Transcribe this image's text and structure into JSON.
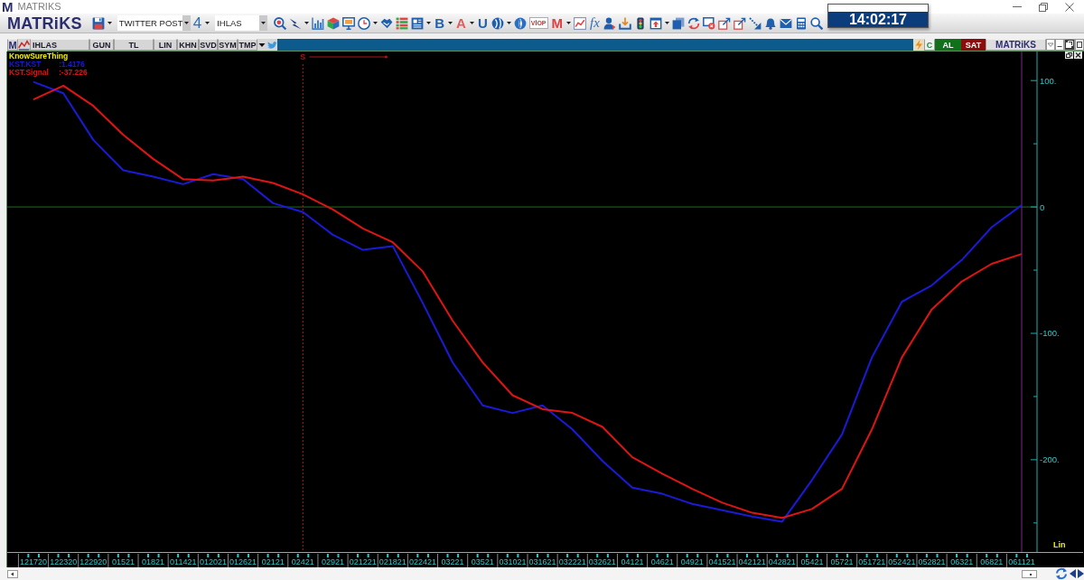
{
  "window": {
    "icon_text": "M",
    "title": "MATRIKS"
  },
  "toolbar": {
    "logo": "MATRiKS",
    "layout_select": {
      "value": "TWITTER POST"
    },
    "page_number": "4",
    "symbol_select": {
      "value": "IHLAS"
    },
    "letter_buttons": [
      {
        "label": "B",
        "color": "#1f5fae"
      },
      {
        "label": "A",
        "color": "#e85a5a"
      },
      {
        "label": "U",
        "color": "#1f5fae"
      },
      {
        "label": "M",
        "color": "#e04040"
      }
    ],
    "viop_label": "VİOP",
    "formula_label": "fx"
  },
  "clock": {
    "time": "14:02:17"
  },
  "chart_window": {
    "logo_text": "M",
    "symbol": "IHLAS",
    "buttons": [
      "GUN",
      "TL",
      "LIN",
      "KHN",
      "SVD",
      "SYM",
      "TMP"
    ],
    "status_letter": "C",
    "buy_label": "AL",
    "sell_label": "SAT",
    "brand": "MATRiKS"
  },
  "chart": {
    "legend_readings": [
      ":1.4176",
      ":-37.226"
    ],
    "scale_mode": "Lin",
    "chart_data": {
      "type": "line",
      "title": "KnowSureThing",
      "categories": [
        "121720",
        "122320",
        "122920",
        "01521",
        "01821",
        "011421",
        "012021",
        "012621",
        "02121",
        "02421",
        "02921",
        "021221",
        "021821",
        "022421",
        "03221",
        "03521",
        "031021",
        "031621",
        "032221",
        "032621",
        "04121",
        "04621",
        "04921",
        "041521",
        "042121",
        "042821",
        "05421",
        "05721",
        "051721",
        "052421",
        "052821",
        "06321",
        "06821",
        "061121"
      ],
      "series": [
        {
          "name": "KST.KST",
          "color": "#1a1ad8",
          "values": [
            99,
            90,
            53,
            29,
            24,
            18,
            26,
            22,
            3,
            -4,
            -22,
            -34,
            -31,
            -76,
            -123,
            -157,
            -163,
            -157,
            -176,
            -201,
            -222,
            -227,
            -235,
            -240,
            -245,
            -249,
            -216,
            -180,
            -119,
            -75,
            -62,
            -42,
            -16,
            1.4
          ]
        },
        {
          "name": "KST.Signal",
          "color": "#e01414",
          "values": [
            85,
            96,
            80,
            57,
            38,
            22,
            21,
            24,
            19,
            10,
            -2,
            -17,
            -28,
            -51,
            -90,
            -123,
            -149,
            -160,
            -163,
            -174,
            -198,
            -211,
            -223,
            -234,
            -242,
            -246,
            -239,
            -223,
            -176,
            -119,
            -81,
            -59,
            -45,
            -37.2
          ]
        }
      ],
      "ylim": [
        -273,
        123
      ],
      "yticks": [
        {
          "value": 100,
          "label": "100."
        },
        {
          "value": 0,
          "label": "0"
        },
        {
          "value": -100,
          "label": "-100."
        },
        {
          "value": -200,
          "label": "-200."
        }
      ],
      "ref_lines": [
        {
          "axis": "y",
          "value": 0,
          "color": "#1c6e1c"
        },
        {
          "axis": "x",
          "value": "02421",
          "color": "#b01414"
        },
        {
          "axis": "x",
          "value": "061121",
          "color": "#7a2a8a"
        }
      ],
      "annotations": [
        "S"
      ]
    }
  }
}
